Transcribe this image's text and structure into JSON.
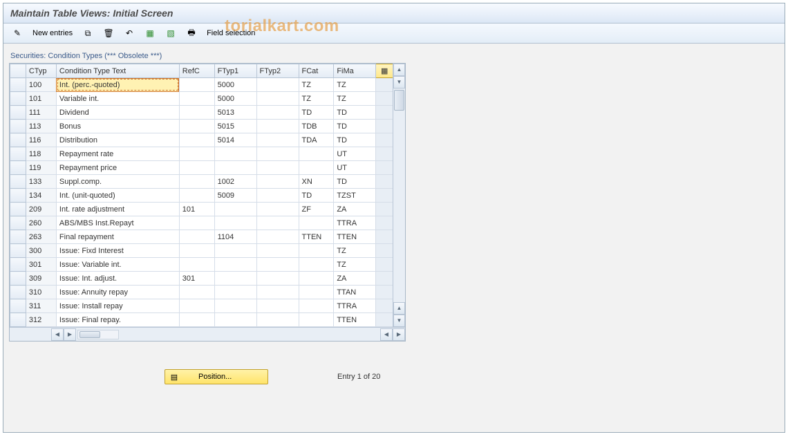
{
  "title": "Maintain Table Views: Initial Screen",
  "watermark": "torialkart.com",
  "toolbar": {
    "new_entries": "New entries",
    "field_selection": "Field selection"
  },
  "panel": {
    "title": "Securities: Condition Types (*** Obsolete ***)"
  },
  "columns": {
    "ctyp": "CTyp",
    "text": "Condition Type Text",
    "refc": "RefC",
    "ftyp1": "FTyp1",
    "ftyp2": "FTyp2",
    "fcat": "FCat",
    "fima": "FiMa"
  },
  "rows": [
    {
      "ctyp": "100",
      "text": "Int. (perc.-quoted)",
      "refc": "",
      "ftyp1": "5000",
      "ftyp2": "",
      "fcat": "TZ",
      "fima": "TZ"
    },
    {
      "ctyp": "101",
      "text": "Variable int.",
      "refc": "",
      "ftyp1": "5000",
      "ftyp2": "",
      "fcat": "TZ",
      "fima": "TZ"
    },
    {
      "ctyp": "111",
      "text": "Dividend",
      "refc": "",
      "ftyp1": "5013",
      "ftyp2": "",
      "fcat": "TD",
      "fima": "TD"
    },
    {
      "ctyp": "113",
      "text": "Bonus",
      "refc": "",
      "ftyp1": "5015",
      "ftyp2": "",
      "fcat": "TDB",
      "fima": "TD"
    },
    {
      "ctyp": "116",
      "text": "Distribution",
      "refc": "",
      "ftyp1": "5014",
      "ftyp2": "",
      "fcat": "TDA",
      "fima": "TD"
    },
    {
      "ctyp": "118",
      "text": "Repayment rate",
      "refc": "",
      "ftyp1": "",
      "ftyp2": "",
      "fcat": "",
      "fima": "UT"
    },
    {
      "ctyp": "119",
      "text": "Repayment price",
      "refc": "",
      "ftyp1": "",
      "ftyp2": "",
      "fcat": "",
      "fima": "UT"
    },
    {
      "ctyp": "133",
      "text": "Suppl.comp.",
      "refc": "",
      "ftyp1": "1002",
      "ftyp2": "",
      "fcat": "XN",
      "fima": "TD"
    },
    {
      "ctyp": "134",
      "text": "Int. (unit-quoted)",
      "refc": "",
      "ftyp1": "5009",
      "ftyp2": "",
      "fcat": "TD",
      "fima": "TZST"
    },
    {
      "ctyp": "209",
      "text": "Int. rate adjustment",
      "refc": "101",
      "ftyp1": "",
      "ftyp2": "",
      "fcat": "ZF",
      "fima": "ZA"
    },
    {
      "ctyp": "260",
      "text": "ABS/MBS Inst.Repayt",
      "refc": "",
      "ftyp1": "",
      "ftyp2": "",
      "fcat": "",
      "fima": "TTRA"
    },
    {
      "ctyp": "263",
      "text": "Final repayment",
      "refc": "",
      "ftyp1": "1104",
      "ftyp2": "",
      "fcat": "TTEN",
      "fima": "TTEN"
    },
    {
      "ctyp": "300",
      "text": "Issue: Fixd Interest",
      "refc": "",
      "ftyp1": "",
      "ftyp2": "",
      "fcat": "",
      "fima": "TZ"
    },
    {
      "ctyp": "301",
      "text": "Issue: Variable int.",
      "refc": "",
      "ftyp1": "",
      "ftyp2": "",
      "fcat": "",
      "fima": "TZ"
    },
    {
      "ctyp": "309",
      "text": "Issue: Int. adjust.",
      "refc": "301",
      "ftyp1": "",
      "ftyp2": "",
      "fcat": "",
      "fima": "ZA"
    },
    {
      "ctyp": "310",
      "text": "Issue: Annuity repay",
      "refc": "",
      "ftyp1": "",
      "ftyp2": "",
      "fcat": "",
      "fima": "TTAN"
    },
    {
      "ctyp": "311",
      "text": "Issue: Install repay",
      "refc": "",
      "ftyp1": "",
      "ftyp2": "",
      "fcat": "",
      "fima": "TTRA"
    },
    {
      "ctyp": "312",
      "text": "Issue: Final repay.",
      "refc": "",
      "ftyp1": "",
      "ftyp2": "",
      "fcat": "",
      "fima": "TTEN"
    }
  ],
  "footer": {
    "position_label": "Position...",
    "status": "Entry 1 of 20"
  },
  "colors": {
    "accent_yellow": "#ffe46a",
    "border_blue": "#a8b8c8"
  }
}
